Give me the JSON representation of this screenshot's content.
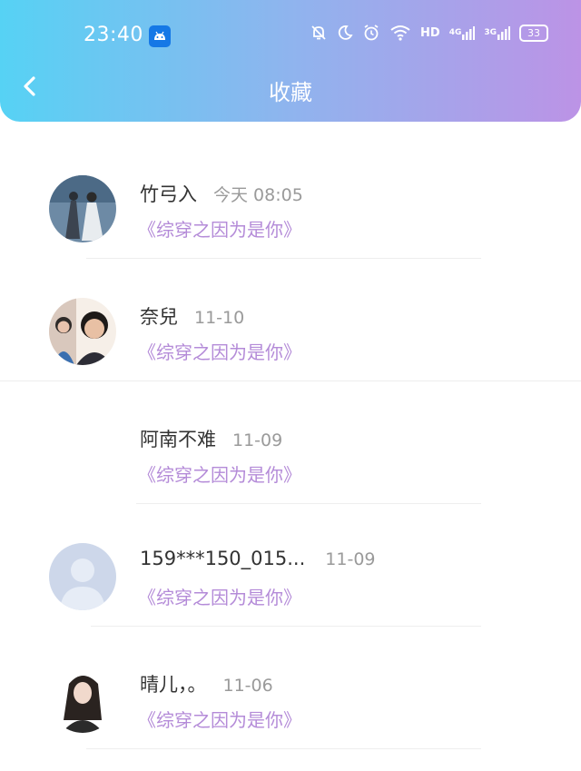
{
  "status_bar": {
    "time": "23:40",
    "network_labels": [
      "HD",
      "4G",
      "3G"
    ],
    "battery": "33"
  },
  "header": {
    "title": "收藏"
  },
  "favorites": [
    {
      "name": "竹弓入",
      "date": "今天 08:05",
      "book": "《综穿之因为是你》",
      "avatar": "photo-avatar"
    },
    {
      "name": "奈兒",
      "date": "11-10",
      "book": "《综穿之因为是你》",
      "avatar": "photo-avatar"
    },
    {
      "name": "阿南不难",
      "date": "11-09",
      "book": "《综穿之因为是你》",
      "avatar": "none"
    },
    {
      "name": "159***150_015...",
      "date": "11-09",
      "book": "《综穿之因为是你》",
      "avatar": "default-avatar"
    },
    {
      "name": "晴儿，。",
      "date": "11-06",
      "book": "《综穿之因为是你》",
      "avatar": "photo-avatar"
    }
  ],
  "colors": {
    "header_gradient": [
      "#56d2f4",
      "#8fb4ee",
      "#bc93e6"
    ],
    "book_title": "#b48bd8",
    "date": "#9a9a9a"
  }
}
